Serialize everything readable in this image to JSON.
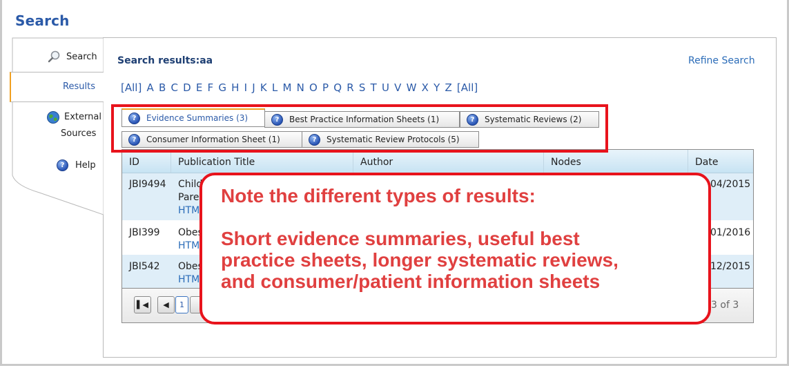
{
  "page": {
    "title": "Search"
  },
  "nav": {
    "search_label": "Search",
    "results_label": "Results",
    "external_label_line1": "External",
    "external_label_line2": "Sources",
    "help_label": "Help"
  },
  "header": {
    "results_heading": "Search results:aa",
    "refine_label": "Refine Search"
  },
  "alphabet": [
    "[All]",
    "A",
    "B",
    "C",
    "D",
    "E",
    "F",
    "G",
    "H",
    "I",
    "J",
    "K",
    "L",
    "M",
    "N",
    "O",
    "P",
    "Q",
    "R",
    "S",
    "T",
    "U",
    "V",
    "W",
    "X",
    "Y",
    "Z",
    "[All]"
  ],
  "tabs": [
    {
      "label": "Evidence Summaries (3)"
    },
    {
      "label": "Best Practice Information Sheets (1)"
    },
    {
      "label": "Systematic Reviews (2)"
    },
    {
      "label": "Consumer Information Sheet (1)"
    },
    {
      "label": "Systematic Review Protocols (5)"
    }
  ],
  "table": {
    "columns": [
      "ID",
      "Publication Title",
      "Author",
      "Nodes",
      "Date"
    ],
    "rows": [
      {
        "id": "JBI9494",
        "title_line1": "Child",
        "title_line2": "Paren",
        "link": "HTM",
        "date": "04/2015"
      },
      {
        "id": "JBI399",
        "title_line1": "Obes",
        "link": "HTM",
        "date": "01/2016"
      },
      {
        "id": "JBI542",
        "title_line1": "Obes",
        "link": "HTM",
        "date": "12/2015"
      }
    ],
    "pager": {
      "current_page": "1",
      "summary": "o 3 of 3"
    }
  },
  "callout": {
    "line1": "Note the different types of results:",
    "line2": "Short evidence summaries, useful best",
    "line3": "practice sheets, longer systematic reviews,",
    "line4": "and consumer/patient information sheets"
  },
  "colors": {
    "accent": "#2b5aa8",
    "highlight_red": "#e8131c",
    "callout_text": "#e04040",
    "tab_active": "#f0a020"
  }
}
